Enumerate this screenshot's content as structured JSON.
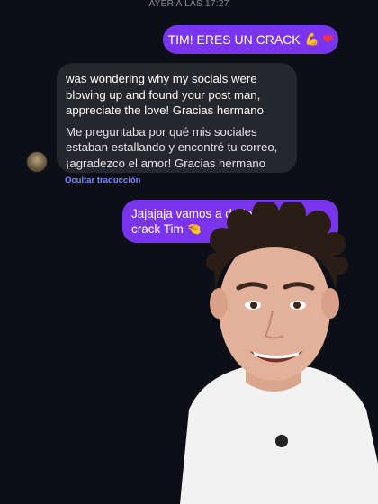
{
  "header": {
    "timestamp": "AYER A LAS 17:27"
  },
  "messages": {
    "sent_1": {
      "text": "TIM! ERES UN CRACK",
      "emoji_icon": "flexed-biceps-icon",
      "heart_icon": "red-heart-icon"
    },
    "received": {
      "original": "was wondering why my socials were blowing up and found your post man, appreciate the love! Gracias hermano",
      "translation": "Me preguntaba por qué mis sociales estaban estallando y encontré tu correo, ¡agradezco el amor! Gracias hermano"
    },
    "hide_translation": "Ocultar traducción",
    "sent_2": {
      "text": "Jajajaja vamos a darle. Eres un crack Tim",
      "emoji_icon": "pinching-hand-icon"
    }
  },
  "colors": {
    "sent_bubble": "#7b34ee",
    "received_bubble": "#26272d",
    "link": "#7b86ff",
    "background": "#0d0f18"
  }
}
